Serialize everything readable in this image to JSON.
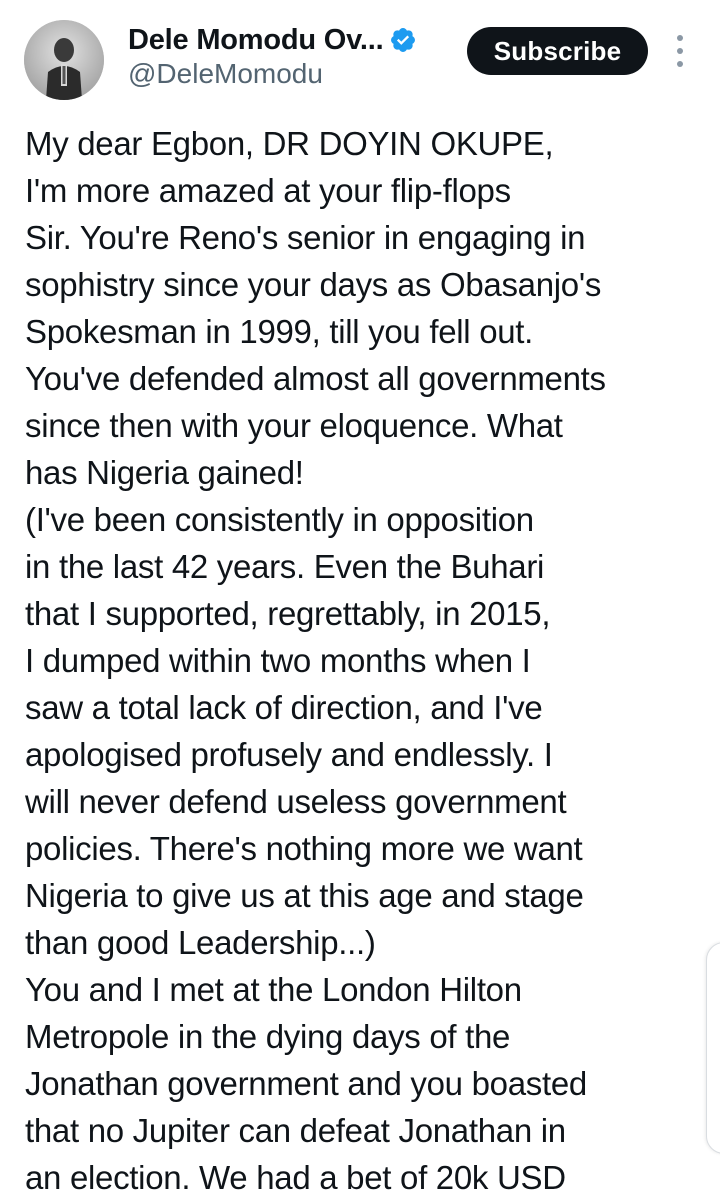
{
  "author": {
    "display_name": "Dele Momodu Ov...",
    "handle": "@DeleMomodu",
    "verified": true,
    "verified_color": "#1d9bf0",
    "avatar_icon": "profile-photo-avatar"
  },
  "actions": {
    "subscribe_label": "Subscribe",
    "more_icon": "vertical-ellipsis-icon"
  },
  "tweet": {
    "lines": [
      "My dear Egbon, DR DOYIN OKUPE,",
      "I'm more amazed at your flip-flops",
      "Sir. You're Reno's senior in engaging in",
      "sophistry since your days as Obasanjo's",
      "Spokesman in 1999, till you fell out.",
      "You've defended almost all governments",
      "since then with your eloquence. What",
      "has Nigeria gained!",
      "(I've been consistently in opposition",
      "in the last 42 years. Even the Buhari",
      "that I supported, regrettably, in 2015,",
      "I dumped within two months when I",
      "saw a total lack of direction, and I've",
      "apologised profusely and endlessly. I",
      "will never defend useless government",
      "policies. There's nothing more we want",
      "Nigeria to give us at this age and stage",
      "than good Leadership...)",
      "You and I met at the London Hilton",
      "Metropole in the dying days of the",
      "Jonathan government and you boasted",
      "that no Jupiter can defeat Jonathan in",
      "an election. We had a bet of 20k USD"
    ]
  },
  "colors": {
    "text": "#0f1419",
    "secondary_text": "#536471",
    "button_bg": "#0f1419",
    "button_text": "#ffffff"
  }
}
